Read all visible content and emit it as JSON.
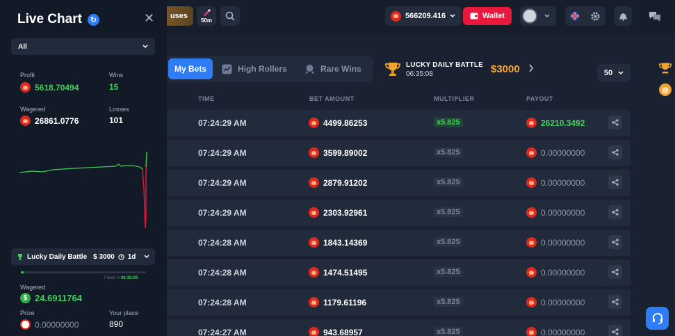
{
  "header": {
    "bonuses_label": "uses",
    "timer_label": "50m",
    "balance": "566209.416",
    "wallet_label": "Wallet"
  },
  "tabs": [
    {
      "label": "My Bets",
      "active": true
    },
    {
      "label": "High Rollers",
      "active": false
    },
    {
      "label": "Rare Wins",
      "active": false
    }
  ],
  "battle": {
    "name": "LUCKY DAILY BATTLE",
    "time": "06:35:08",
    "amount": "$3000"
  },
  "per_page": "50",
  "table": {
    "headers": [
      "TIME",
      "BET AMOUNT",
      "MULTIPLIER",
      "PAYOUT"
    ],
    "rows": [
      {
        "time": "07:24:29 AM",
        "bet": "4499.86253",
        "mult": "x5.825",
        "payout": "26210.3492",
        "win": true
      },
      {
        "time": "07:24:29 AM",
        "bet": "3599.89002",
        "mult": "x5.825",
        "payout": "0.00000000",
        "win": false
      },
      {
        "time": "07:24:29 AM",
        "bet": "2879.91202",
        "mult": "x5.825",
        "payout": "0.00000000",
        "win": false
      },
      {
        "time": "07:24:29 AM",
        "bet": "2303.92961",
        "mult": "x5.825",
        "payout": "0.00000000",
        "win": false
      },
      {
        "time": "07:24:28 AM",
        "bet": "1843.14369",
        "mult": "x5.825",
        "payout": "0.00000000",
        "win": false
      },
      {
        "time": "07:24:28 AM",
        "bet": "1474.51495",
        "mult": "x5.825",
        "payout": "0.00000000",
        "win": false
      },
      {
        "time": "07:24:28 AM",
        "bet": "1179.61196",
        "mult": "x5.825",
        "payout": "0.00000000",
        "win": false
      },
      {
        "time": "07:24:27 AM",
        "bet": "943.68957",
        "mult": "x5.825",
        "payout": "0.00000000",
        "win": false
      }
    ]
  },
  "live_chart": {
    "title": "Live Chart",
    "filter": "All",
    "profit_label": "Profit",
    "profit": "5618.70494",
    "wins_label": "Wins",
    "wins": "15",
    "wagered_label": "Wagered",
    "wagered": "26861.0776",
    "losses_label": "Losses",
    "losses": "101",
    "battle_name": "Lucky Daily Battle",
    "battle_amount": "$ 3000",
    "battle_duration": "1d",
    "finish_label": "Finish in",
    "finish_time": "06:35:08",
    "battle_progress": 0.02,
    "battle_wagered_label": "Wagered",
    "battle_wagered": "24.6911764",
    "prize_label": "Prize",
    "prize": "0.00000000",
    "place_label": "Your place",
    "place": "890"
  },
  "colors": {
    "accent": "#2e7cf6",
    "wallet": "#e8193c",
    "win": "#3fcf5a",
    "loss": "#e8193c",
    "gold": "#f7a737"
  }
}
